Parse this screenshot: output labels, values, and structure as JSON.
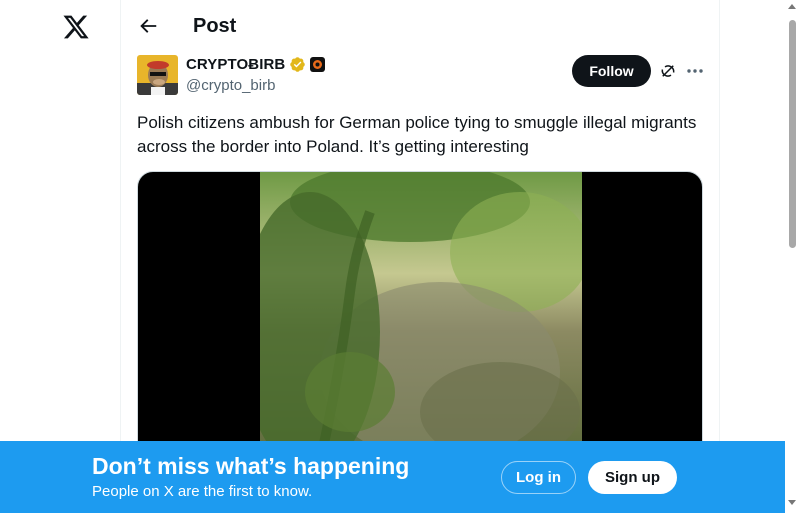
{
  "app": {
    "logo_icon": "x-logo-icon"
  },
  "header": {
    "back_icon": "arrow-left-icon",
    "title": "Post"
  },
  "post": {
    "author": {
      "display_name": "CRYPTOɃIRB",
      "handle": "@crypto_birb",
      "verified_icon": "gold-verified-badge-icon",
      "affiliation_icon": "affiliate-badge-icon"
    },
    "follow_label": "Follow",
    "grok_icon": "grok-icon",
    "more_icon": "more-options-icon",
    "text": "Polish citizens ambush for German police tying to smuggle illegal migrants across the border into Poland. It’s getting interesting",
    "media": {
      "type": "video",
      "description_icon": "video-player"
    }
  },
  "banner": {
    "title": "Don’t miss what’s happening",
    "subtitle": "People on X are the first to know.",
    "login_label": "Log in",
    "signup_label": "Sign up"
  },
  "colors": {
    "accent": "#1d9bf0",
    "text": "#0f1419",
    "muted": "#536471",
    "verified": "#e2b719"
  }
}
